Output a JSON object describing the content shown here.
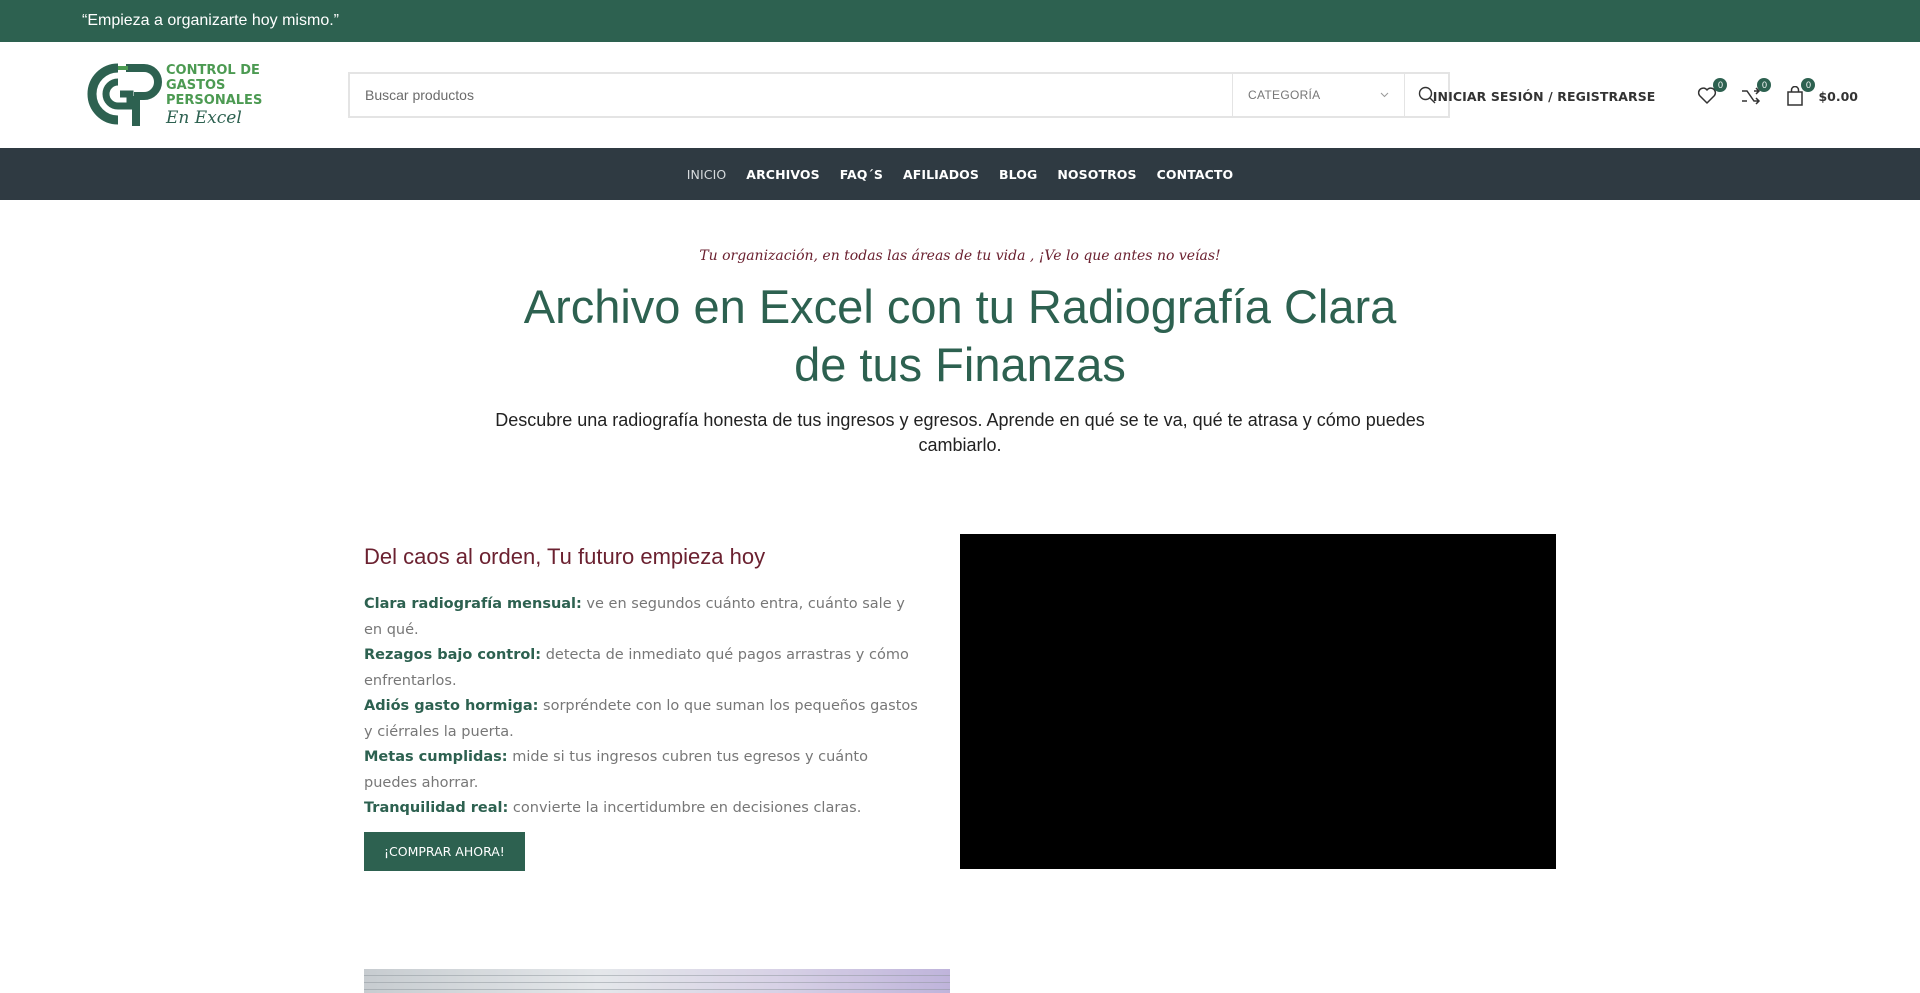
{
  "topbar": {
    "text": "“Empieza a organizarte hoy mismo.”"
  },
  "logo": {
    "line1": "CONTROL DE",
    "line2": "GASTOS",
    "line3": "PERSONALES",
    "line4": "En Excel"
  },
  "search": {
    "placeholder": "Buscar productos",
    "category": "CATEGORÍA"
  },
  "header": {
    "login": "INICIAR SESIÓN / REGISTRARSE",
    "wishlist_count": "0",
    "compare_count": "0",
    "cart_count": "0",
    "cart_total": "$0.00"
  },
  "nav": {
    "items": [
      "INICIO",
      "ARCHIVOS",
      "FAQ´S",
      "AFILIADOS",
      "BLOG",
      "NOSOTROS",
      "CONTACTO"
    ]
  },
  "hero": {
    "tagline": "Tu organización, en todas las áreas de tu vida , ¡Ve lo que antes no veías!",
    "title": "Archivo en Excel con tu Radiografía Clara de tus Finanzas",
    "subtitle": "Descubre una radiografía honesta de tus ingresos y egresos. Aprende en qué se te va, qué te atrasa y cómo puedes cambiarlo."
  },
  "section": {
    "title": "Del caos al orden, Tu futuro empieza hoy",
    "features": [
      {
        "label": "Clara radiografía mensual:",
        "text": " ve en segundos cuánto entra, cuánto sale y en qué."
      },
      {
        "label": "Rezagos bajo control:",
        "text": " detecta de inmediato qué pagos arrastras y cómo enfrentarlos."
      },
      {
        "label": "Adiós gasto hormiga:",
        "text": " sorpréndete con lo que suman los pequeños gastos y ciérrales la puerta."
      },
      {
        "label": "Metas cumplidas:",
        "text": " mide si tus ingresos cubren tus egresos y cuánto puedes ahorrar."
      },
      {
        "label": "Tranquilidad real:",
        "text": " convierte la incertidumbre en decisiones claras."
      }
    ],
    "button": "¡COMPRAR AHORA!"
  },
  "colors": {
    "brand_green": "#2d6150",
    "logo_green": "#4c9a52",
    "maroon": "#6b2130",
    "nav_bg": "#2f3a42"
  }
}
